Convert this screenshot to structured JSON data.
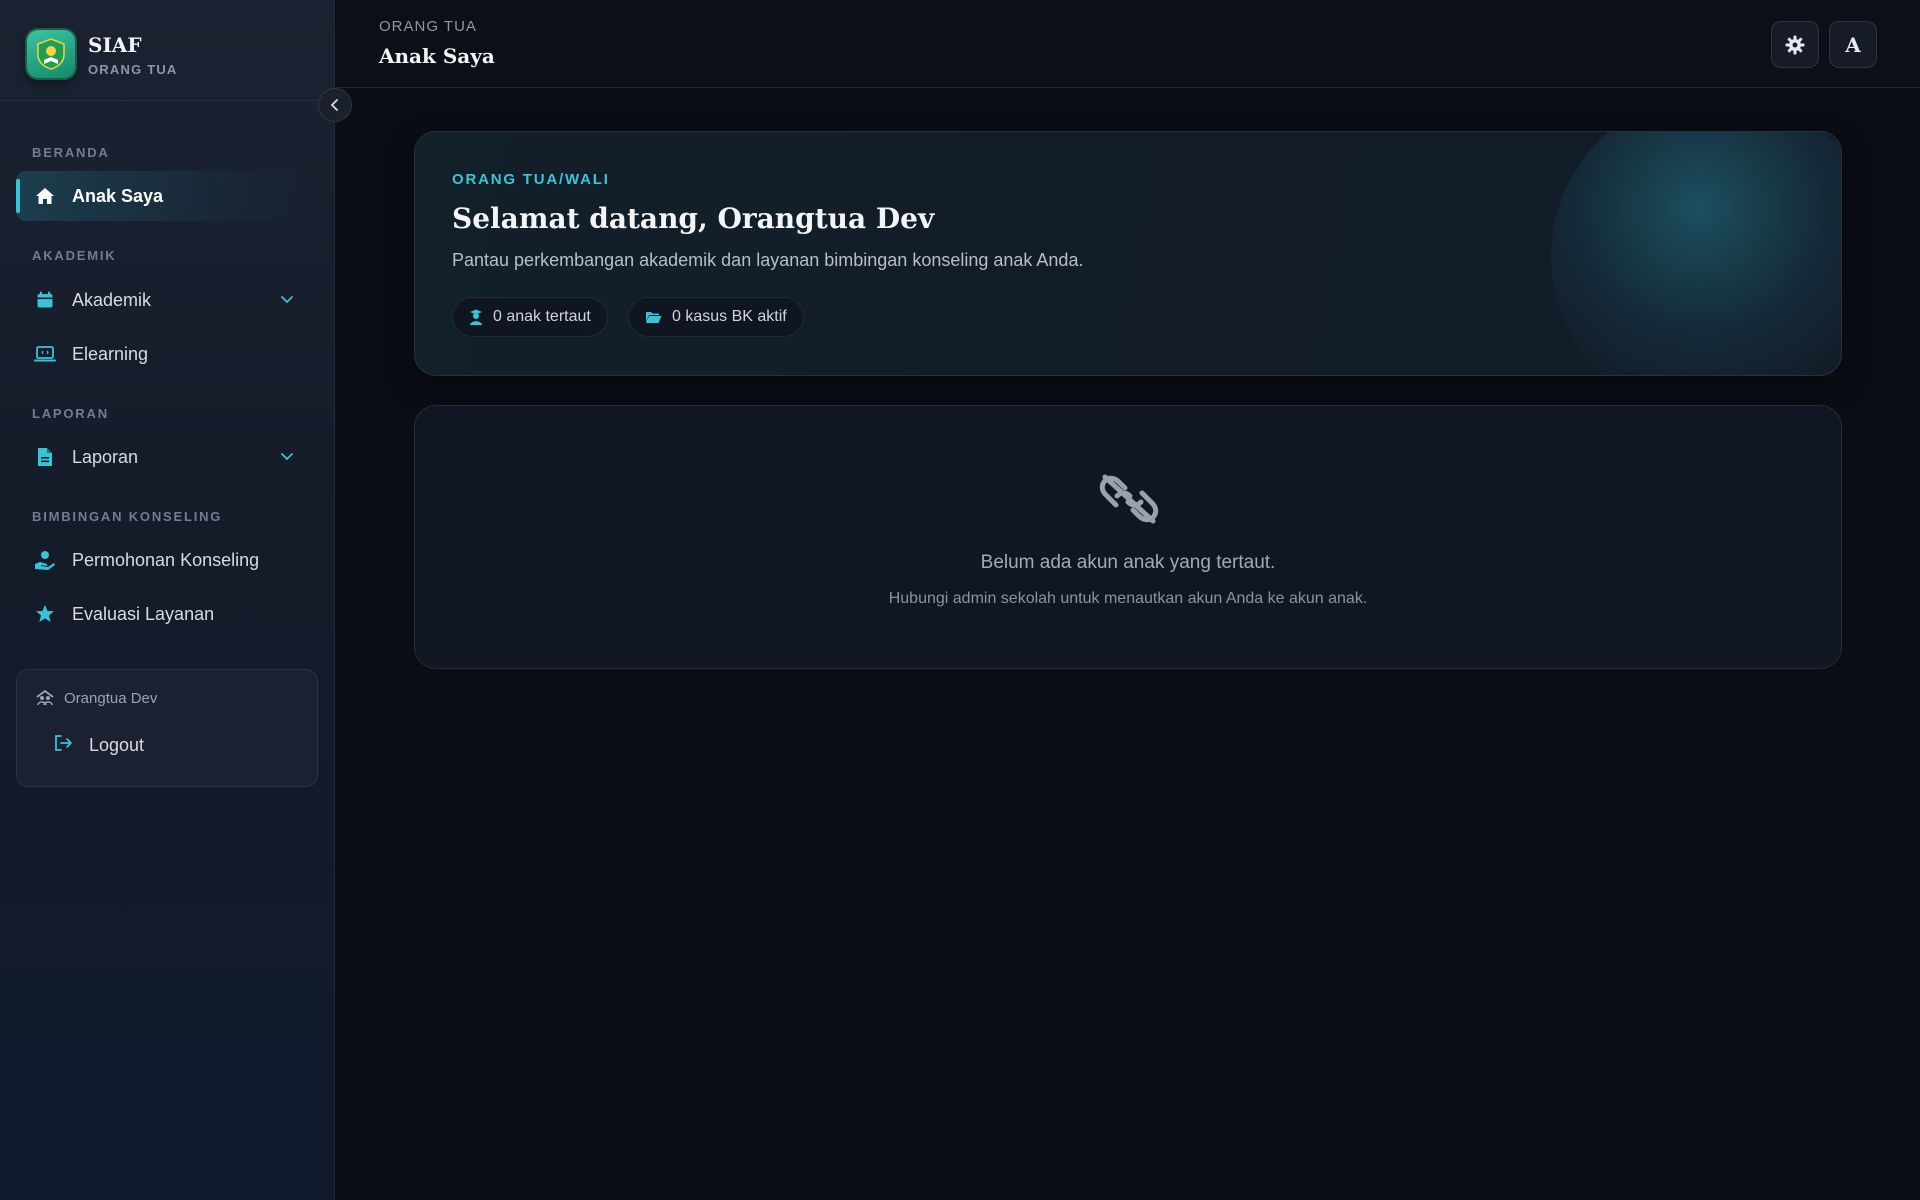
{
  "brand": {
    "title": "SIAF",
    "subtitle": "ORANG TUA"
  },
  "sidebar": {
    "sections": [
      {
        "label": "BERANDA"
      },
      {
        "label": "AKADEMIK"
      },
      {
        "label": "LAPORAN"
      },
      {
        "label": "BIMBINGAN KONSELING"
      }
    ],
    "items": [
      {
        "label": "Anak Saya",
        "icon": "home-icon",
        "active": true
      },
      {
        "label": "Akademik",
        "icon": "calendar-icon",
        "expandable": true
      },
      {
        "label": "Elearning",
        "icon": "laptop-icon"
      },
      {
        "label": "Laporan",
        "icon": "document-icon",
        "expandable": true
      },
      {
        "label": "Permohonan Konseling",
        "icon": "hand-person-icon"
      },
      {
        "label": "Evaluasi Layanan",
        "icon": "star-icon"
      }
    ],
    "user": {
      "name": "Orangtua Dev",
      "logout_label": "Logout"
    }
  },
  "header": {
    "breadcrumb": "ORANG TUA",
    "title": "Anak Saya",
    "lang_label": "A"
  },
  "welcome": {
    "eyebrow": "ORANG TUA/WALI",
    "title": "Selamat datang, Orangtua Dev",
    "description": "Pantau perkembangan akademik dan layanan bimbingan konseling anak Anda.",
    "pills": [
      {
        "label": "0 anak tertaut",
        "icon": "student-icon"
      },
      {
        "label": "0 kasus BK aktif",
        "icon": "folder-open-icon"
      }
    ]
  },
  "empty_state": {
    "icon": "unlink-icon",
    "title": "Belum ada akun anak yang tertaut.",
    "subtitle": "Hubungi admin sekolah untuk menautkan akun Anda ke akun anak."
  },
  "colors": {
    "accent": "#36c4d6",
    "background": "#0a0e14",
    "sidebar": "#141b29"
  }
}
